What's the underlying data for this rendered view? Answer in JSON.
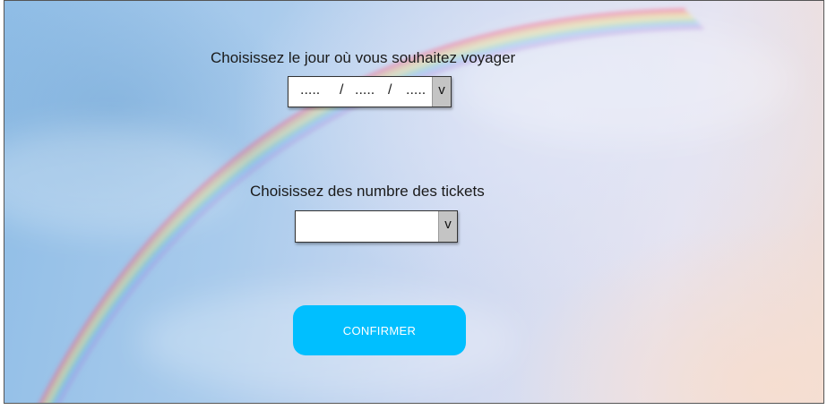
{
  "date_picker": {
    "label": "Choisissez le jour où vous souhaitez voyager",
    "day": ".....",
    "month": ".....",
    "year": ".....",
    "separator": "/",
    "arrow": "v"
  },
  "tickets_picker": {
    "label": "Choisissez des numbre des tickets",
    "value": "",
    "arrow": "v"
  },
  "confirm": {
    "label": "CONFIRMER",
    "color": "#00bfff"
  },
  "background": {
    "image": "rainbow-sky"
  }
}
